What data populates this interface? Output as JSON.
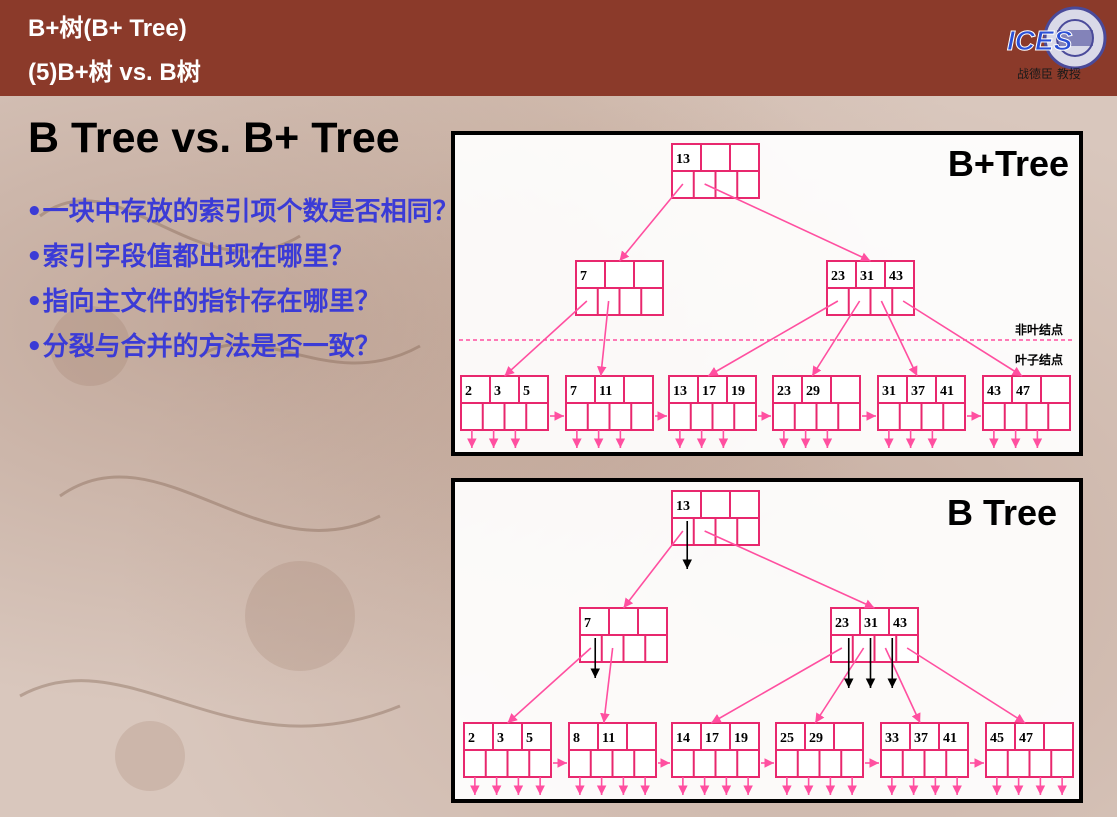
{
  "header": {
    "title_line1": "B+树(B+ Tree)",
    "title_line2": "(5)B+树 vs. B树",
    "logo_text": "ICES",
    "logo_caption": "战德臣 教授"
  },
  "slide": {
    "title": "B Tree  vs. B+ Tree",
    "questions": [
      "•一块中存放的索引项个数是否相同？",
      "•索引字段值都出现在哪里？",
      "•指向主文件的指针存在哪里？",
      "•分裂与合并的方法是否一致？"
    ]
  },
  "bplus": {
    "label": "B+Tree",
    "nonleaf_label": "非叶结点",
    "leaf_label": "叶子结点",
    "root": [
      "13"
    ],
    "internal": [
      [
        "7"
      ],
      [
        "23",
        "31",
        "43"
      ]
    ],
    "leaves": [
      [
        "2",
        "3",
        "5"
      ],
      [
        "7",
        "11"
      ],
      [
        "13",
        "17",
        "19"
      ],
      [
        "23",
        "29"
      ],
      [
        "31",
        "37",
        "41"
      ],
      [
        "43",
        "47"
      ]
    ]
  },
  "btree": {
    "label": "B Tree",
    "root": [
      "13"
    ],
    "internal": [
      [
        "7"
      ],
      [
        "23",
        "31",
        "43"
      ]
    ],
    "leaves": [
      [
        "2",
        "3",
        "5"
      ],
      [
        "8",
        "11"
      ],
      [
        "14",
        "17",
        "19"
      ],
      [
        "25",
        "29"
      ],
      [
        "33",
        "37",
        "41"
      ],
      [
        "45",
        "47"
      ]
    ]
  },
  "colors": {
    "header_bg": "#8b3a2a",
    "question_text": "#3b3bd6",
    "node_border": "#e8286e",
    "arrow": "#ff4fa0"
  }
}
